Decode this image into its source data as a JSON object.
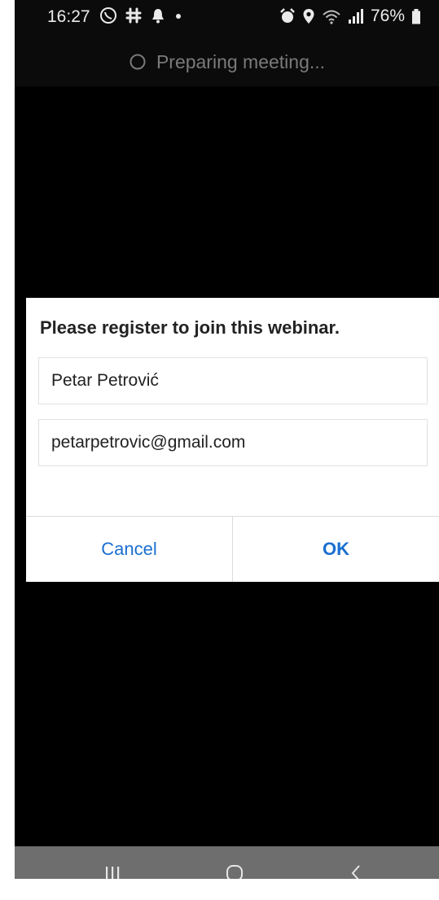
{
  "status_bar": {
    "time": "16:27",
    "battery": "76%",
    "left_icons": [
      "viber-icon",
      "slack-icon",
      "notification-bell-icon",
      "dot-icon"
    ],
    "right_icons": [
      "alarm-icon",
      "location-icon",
      "wifi-icon",
      "signal-icon",
      "battery-icon"
    ]
  },
  "header": {
    "preparing_text": "Preparing meeting..."
  },
  "dialog": {
    "title": "Please register to join this webinar.",
    "name_value": "Petar Petrović",
    "email_value": "petarpetrovic@gmail.com",
    "cancel_label": "Cancel",
    "ok_label": "OK",
    "accent_color": "#1a6fd0"
  },
  "nav_bar": {
    "icons": [
      "recents-icon",
      "home-icon",
      "back-icon"
    ]
  }
}
